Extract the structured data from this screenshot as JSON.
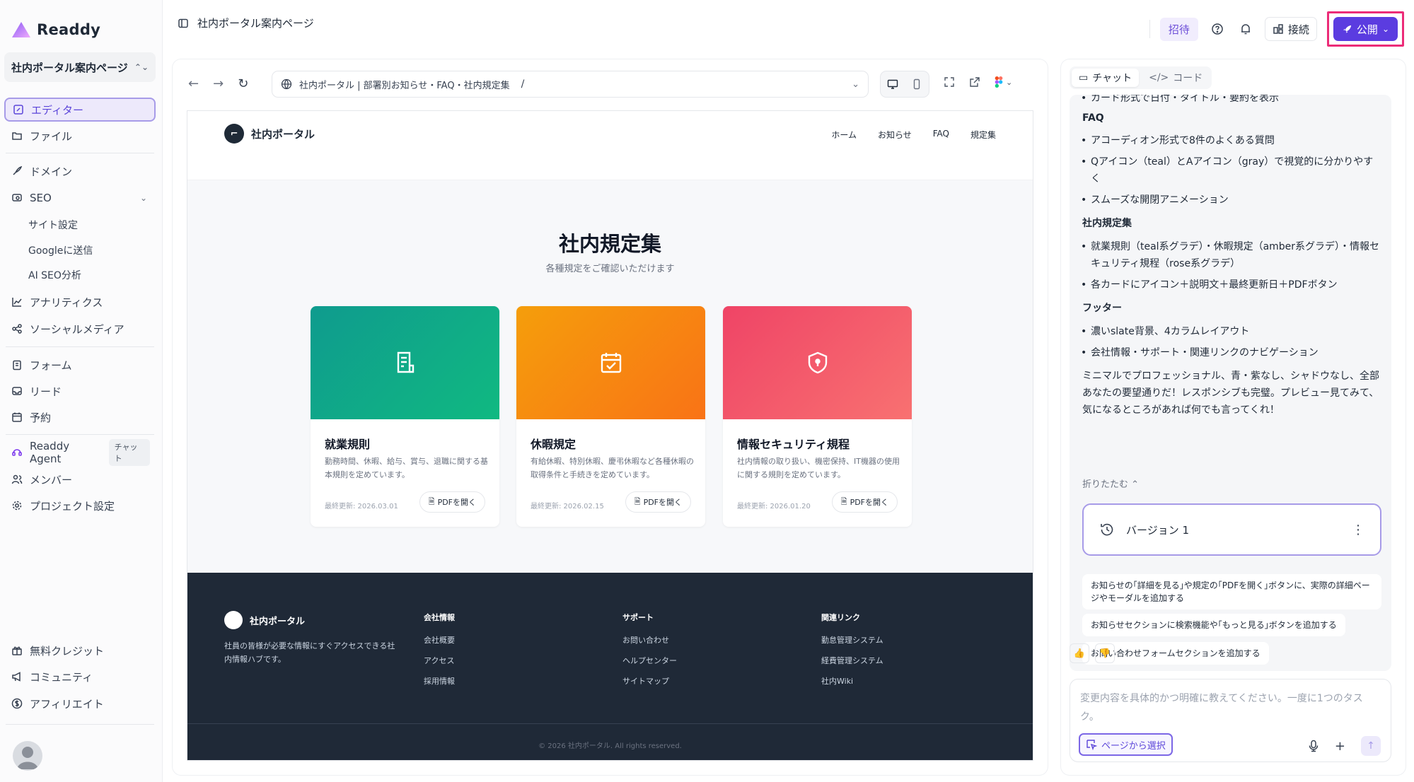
{
  "app": {
    "name": "Readdy"
  },
  "sidebar": {
    "project_name": "社内ポータル案内ページ",
    "items": [
      {
        "label": "エディター",
        "icon": "edit-icon"
      },
      {
        "label": "ファイル",
        "icon": "folder-icon"
      },
      {
        "label": "ドメイン",
        "icon": "rocket-icon"
      },
      {
        "label": "SEO",
        "icon": "seo-icon"
      },
      {
        "label": "アナリティクス",
        "icon": "chart-icon"
      },
      {
        "label": "ソーシャルメディア",
        "icon": "share-icon"
      },
      {
        "label": "フォーム",
        "icon": "clipboard-icon"
      },
      {
        "label": "リード",
        "icon": "inbox-icon"
      },
      {
        "label": "予約",
        "icon": "calendar-icon"
      },
      {
        "label": "Readdy Agent",
        "icon": "agent-icon",
        "tag": "チャット"
      },
      {
        "label": "メンバー",
        "icon": "users-icon"
      },
      {
        "label": "プロジェクト設定",
        "icon": "gear-icon"
      },
      {
        "label": "無料クレジット",
        "icon": "gift-icon"
      },
      {
        "label": "コミュニティ",
        "icon": "megaphone-icon"
      },
      {
        "label": "アフィリエイト",
        "icon": "dollar-icon"
      }
    ],
    "seo_sub": [
      "サイト設定",
      "Googleに送信",
      "AI SEO分析"
    ]
  },
  "topbar": {
    "page_title": "社内ポータル案内ページ",
    "invite": "招待",
    "connect": "接続",
    "publish": "公開"
  },
  "editor": {
    "url": "社内ポータル | 部署別お知らせ・FAQ・社内規定集",
    "url_path": "/"
  },
  "site": {
    "brand": "社内ポータル",
    "nav": [
      "ホーム",
      "お知らせ",
      "FAQ",
      "規定集"
    ],
    "section_title": "社内規定集",
    "section_sub": "各種規定をご確認いただけます",
    "cards": [
      {
        "title": "就業規則",
        "desc": "勤務時間、休暇、給与、賞与、退職に関する基本規則を定めています。",
        "date": "最終更新: 2026.03.01",
        "button": "PDFを開く"
      },
      {
        "title": "休暇規定",
        "desc": "有給休暇、特別休暇、慶弔休暇など各種休暇の取得条件と手続きを定めています。",
        "date": "最終更新: 2026.02.15",
        "button": "PDFを開く"
      },
      {
        "title": "情報セキュリティ規程",
        "desc": "社内情報の取り扱い、機密保持、IT機器の使用に関する規則を定めています。",
        "date": "最終更新: 2026.01.20",
        "button": "PDFを開く"
      }
    ],
    "footer": {
      "brand": "社内ポータル",
      "desc": "社員の皆様が必要な情報にすぐアクセスできる社内情報ハブです。",
      "cols": [
        {
          "heading": "会社情報",
          "links": [
            "会社概要",
            "アクセス",
            "採用情報"
          ]
        },
        {
          "heading": "サポート",
          "links": [
            "お問い合わせ",
            "ヘルプセンター",
            "サイトマップ"
          ]
        },
        {
          "heading": "関連リンク",
          "links": [
            "勤怠管理システム",
            "経費管理システム",
            "社内Wiki"
          ]
        }
      ],
      "copyright": "© 2026 社内ポータル. All rights reserved."
    }
  },
  "chat": {
    "tabs": [
      "チャット",
      "コード"
    ],
    "lines": [
      {
        "type": "bullet",
        "text": "カード形式で日付・タイトル・要約を表示"
      },
      {
        "type": "heading",
        "text": "FAQ"
      },
      {
        "type": "bullet",
        "text": "アコーディオン形式で8件のよくある質問"
      },
      {
        "type": "bullet",
        "text": "Qアイコン（teal）とAアイコン（gray）で視覚的に分かりやすく"
      },
      {
        "type": "bullet",
        "text": "スムーズな開閉アニメーション"
      },
      {
        "type": "heading",
        "text": "社内規定集"
      },
      {
        "type": "bullet",
        "text": "就業規則（teal系グラデ）・休暇規定（amber系グラデ）・情報セキュリティ規程（rose系グラデ）"
      },
      {
        "type": "bullet",
        "text": "各カードにアイコン＋説明文＋最終更新日＋PDFボタン"
      },
      {
        "type": "heading",
        "text": "フッター"
      },
      {
        "type": "bullet",
        "text": "濃いslate背景、4カラムレイアウト"
      },
      {
        "type": "bullet",
        "text": "会社情報・サポート・関連リンクのナビゲーション"
      },
      {
        "type": "para",
        "text": "ミニマルでプロフェッショナル、青・紫なし、シャドウなし、全部あなたの要望通りだ！レスポンシブも完璧。プレビュー見てみて、気になるところがあれば何でも言ってくれ！"
      }
    ],
    "collapse": "折りたたむ",
    "version": "バージョン 1",
    "suggestions": [
      "お知らせの｢詳細を見る｣や規定の｢PDFを開く｣ボタンに、実際の詳細ページやモーダルを追加する",
      "お知らせセクションに検索機能や｢もっと見る｣ボタンを追加する",
      "お問い合わせフォームセクションを追加する"
    ],
    "composer_placeholder": "変更内容を具体的かつ明確に教えてください。一度に1つのタスク。",
    "select_from_page": "ページから選択"
  }
}
